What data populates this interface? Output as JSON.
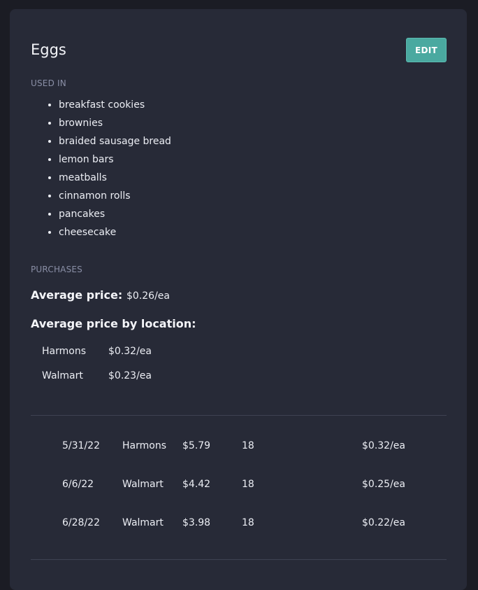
{
  "ingredient": {
    "title": "Eggs",
    "edit_label": "EDIT"
  },
  "used_in": {
    "label": "USED IN",
    "recipes": [
      "breakfast cookies",
      "brownies",
      "braided sausage bread",
      "lemon bars",
      "meatballs",
      "cinnamon rolls",
      "pancakes",
      "cheesecake"
    ]
  },
  "purchases": {
    "label": "PURCHASES",
    "average_label": "Average price:",
    "average_value": "$0.26/ea",
    "by_location_label": "Average price by location:",
    "by_location": [
      {
        "location": "Harmons",
        "price": "$0.32/ea"
      },
      {
        "location": "Walmart",
        "price": "$0.23/ea"
      }
    ],
    "history": [
      {
        "date": "5/31/22",
        "store": "Harmons",
        "price": "$5.79",
        "quantity": "18",
        "unit_price": "$0.32/ea"
      },
      {
        "date": "6/6/22",
        "store": "Walmart",
        "price": "$4.42",
        "quantity": "18",
        "unit_price": "$0.25/ea"
      },
      {
        "date": "6/28/22",
        "store": "Walmart",
        "price": "$3.98",
        "quantity": "18",
        "unit_price": "$0.22/ea"
      }
    ]
  }
}
